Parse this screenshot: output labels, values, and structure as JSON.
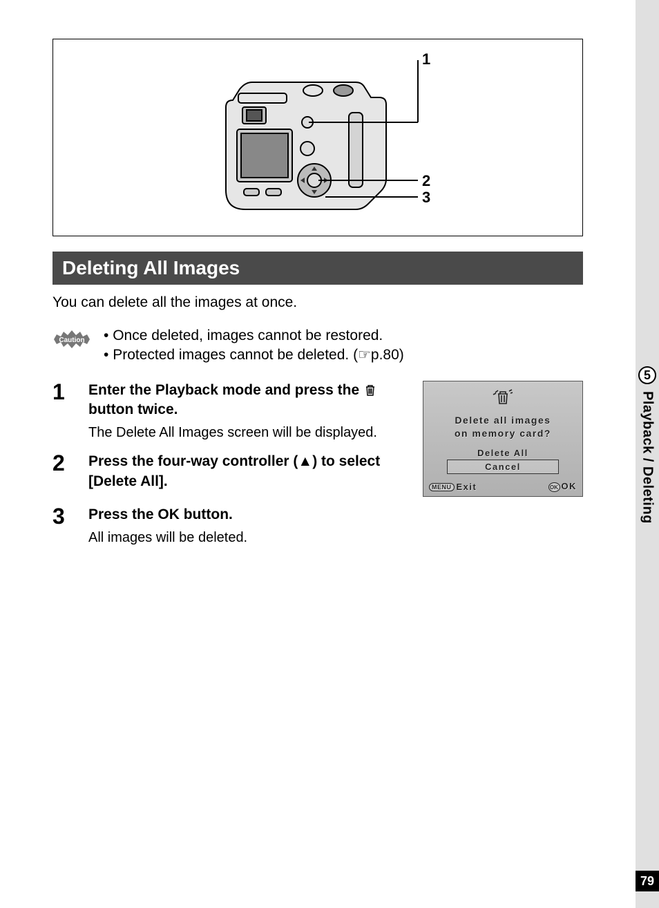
{
  "diagram": {
    "callouts": [
      "1",
      "2",
      "3"
    ]
  },
  "heading": "Deleting All Images",
  "intro": "You can delete all the images at once.",
  "caution": {
    "label": "Caution",
    "items": [
      "Once deleted, images cannot be restored.",
      "Protected images cannot be deleted. (☞p.80)"
    ]
  },
  "steps": [
    {
      "num": "1",
      "title_before": "Enter the Playback mode and press the ",
      "title_after": " button twice.",
      "text": "The Delete All Images screen will be displayed."
    },
    {
      "num": "2",
      "title": "Press the four-way controller (▲) to select [Delete All].",
      "text": ""
    },
    {
      "num": "3",
      "title": "Press the OK button.",
      "text": "All images will be deleted."
    }
  ],
  "lcd": {
    "prompt_line1": "Delete all images",
    "prompt_line2": "on memory card?",
    "option_delete": "Delete All",
    "option_cancel": "Cancel",
    "menu_label": "MENU",
    "exit": "Exit",
    "ok_btn": "OK",
    "ok": "OK"
  },
  "side": {
    "chapter": "5",
    "label": "Playback / Deleting"
  },
  "page_number": "79"
}
